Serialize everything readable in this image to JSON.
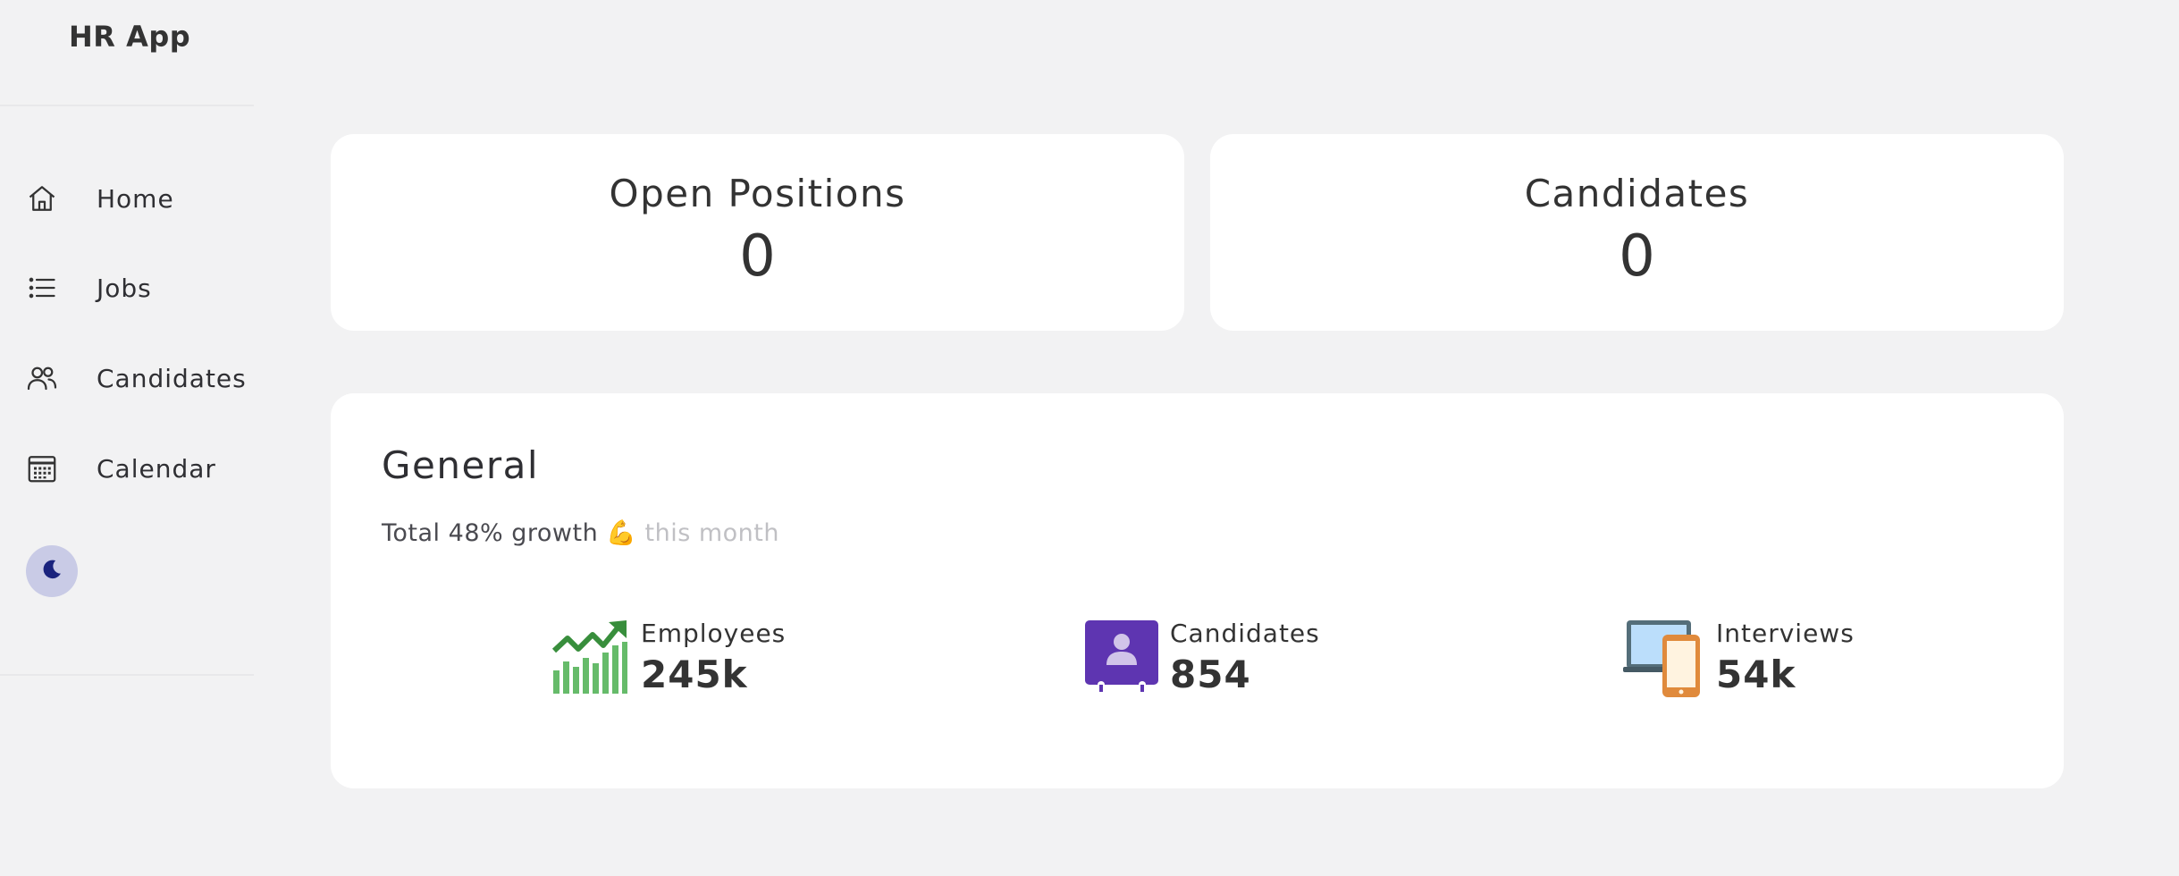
{
  "app": {
    "title": "HR App"
  },
  "sidebar": {
    "items": [
      {
        "label": "Home",
        "icon": "home-icon"
      },
      {
        "label": "Jobs",
        "icon": "list-icon"
      },
      {
        "label": "Candidates",
        "icon": "users-icon"
      },
      {
        "label": "Calendar",
        "icon": "calendar-icon"
      }
    ],
    "theme_toggle_icon": "moon-icon"
  },
  "stats": [
    {
      "title": "Open Positions",
      "value": "0"
    },
    {
      "title": "Candidates",
      "value": "0"
    }
  ],
  "general": {
    "title": "General",
    "growth_prefix": "Total 48% growth",
    "growth_emoji": "💪",
    "growth_suffix": "this month",
    "metrics": [
      {
        "label": "Employees",
        "value": "245k",
        "icon": "growth-chart-icon"
      },
      {
        "label": "Candidates",
        "value": "854",
        "icon": "person-badge-icon"
      },
      {
        "label": "Interviews",
        "value": "54k",
        "icon": "devices-icon"
      }
    ]
  },
  "colors": {
    "background": "#f2f2f3",
    "card": "#ffffff",
    "chart_green": "#4caf50",
    "badge_purple": "#5e35b1",
    "theme_toggle_bg": "#c9cbe6",
    "moon": "#1a237e"
  }
}
